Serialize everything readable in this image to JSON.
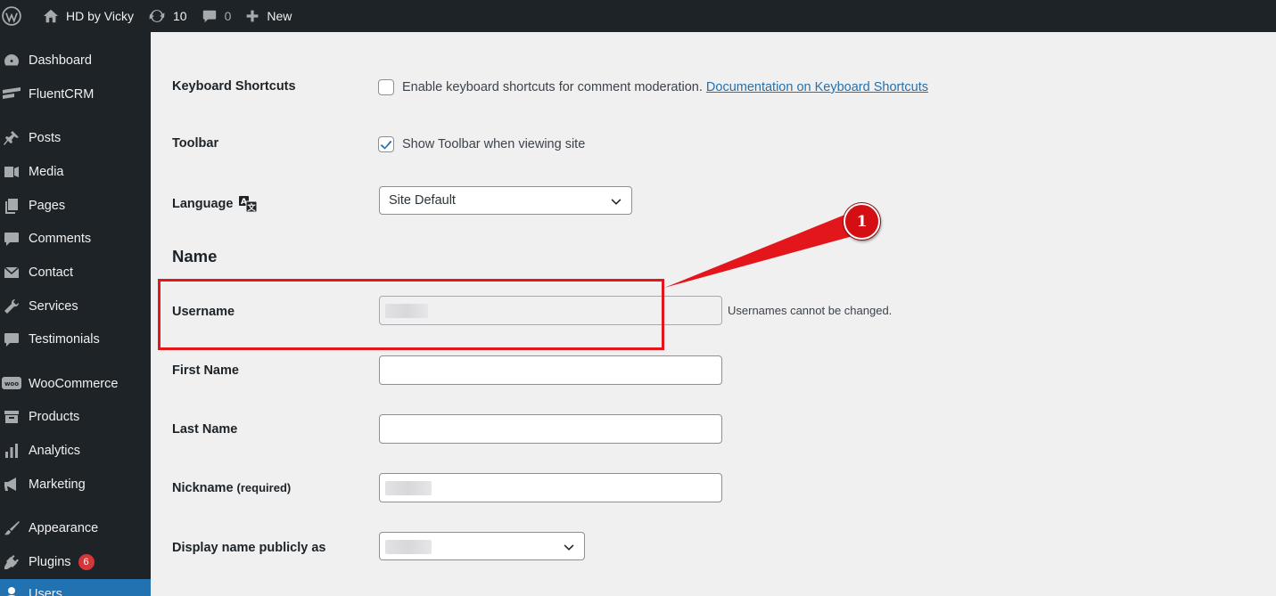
{
  "adminbar": {
    "site_name": "HD by Vicky",
    "updates_count": "10",
    "comments_count": "0",
    "new_label": "New"
  },
  "sidebar": {
    "items": [
      {
        "label": "Dashboard",
        "icon": "dashboard-icon"
      },
      {
        "label": "FluentCRM",
        "icon": "fluentcrm-icon"
      },
      {
        "label": "Posts",
        "icon": "pin-icon"
      },
      {
        "label": "Media",
        "icon": "media-icon"
      },
      {
        "label": "Pages",
        "icon": "pages-icon"
      },
      {
        "label": "Comments",
        "icon": "comment-icon"
      },
      {
        "label": "Contact",
        "icon": "mail-icon"
      },
      {
        "label": "Services",
        "icon": "wrench-icon"
      },
      {
        "label": "Testimonials",
        "icon": "comment-icon"
      },
      {
        "label": "WooCommerce",
        "icon": "woo-icon"
      },
      {
        "label": "Products",
        "icon": "archive-icon"
      },
      {
        "label": "Analytics",
        "icon": "bar-chart-icon"
      },
      {
        "label": "Marketing",
        "icon": "megaphone-icon"
      },
      {
        "label": "Appearance",
        "icon": "paintbrush-icon"
      },
      {
        "label": "Plugins",
        "icon": "plugin-icon",
        "badge": "6"
      },
      {
        "label": "Users",
        "icon": "user-icon"
      }
    ]
  },
  "form": {
    "keyboard_shortcuts": {
      "label": "Keyboard Shortcuts",
      "text": "Enable keyboard shortcuts for comment moderation.",
      "link": "Documentation on Keyboard Shortcuts",
      "checked": false
    },
    "toolbar": {
      "label": "Toolbar",
      "text": "Show Toolbar when viewing site",
      "checked": true
    },
    "language": {
      "label": "Language",
      "value": "Site Default"
    },
    "name_section": "Name",
    "username": {
      "label": "Username",
      "description": "Usernames cannot be changed."
    },
    "first_name": {
      "label": "First Name",
      "value": ""
    },
    "last_name": {
      "label": "Last Name",
      "value": ""
    },
    "nickname": {
      "label": "Nickname",
      "required": "(required)"
    },
    "display_name": {
      "label": "Display name publicly as"
    }
  },
  "annotation": {
    "marker_number": "1",
    "color": "#e3161b"
  },
  "colors": {
    "adminbar_bg": "#1d2327",
    "accent": "#2271b1",
    "badge": "#d63638"
  }
}
